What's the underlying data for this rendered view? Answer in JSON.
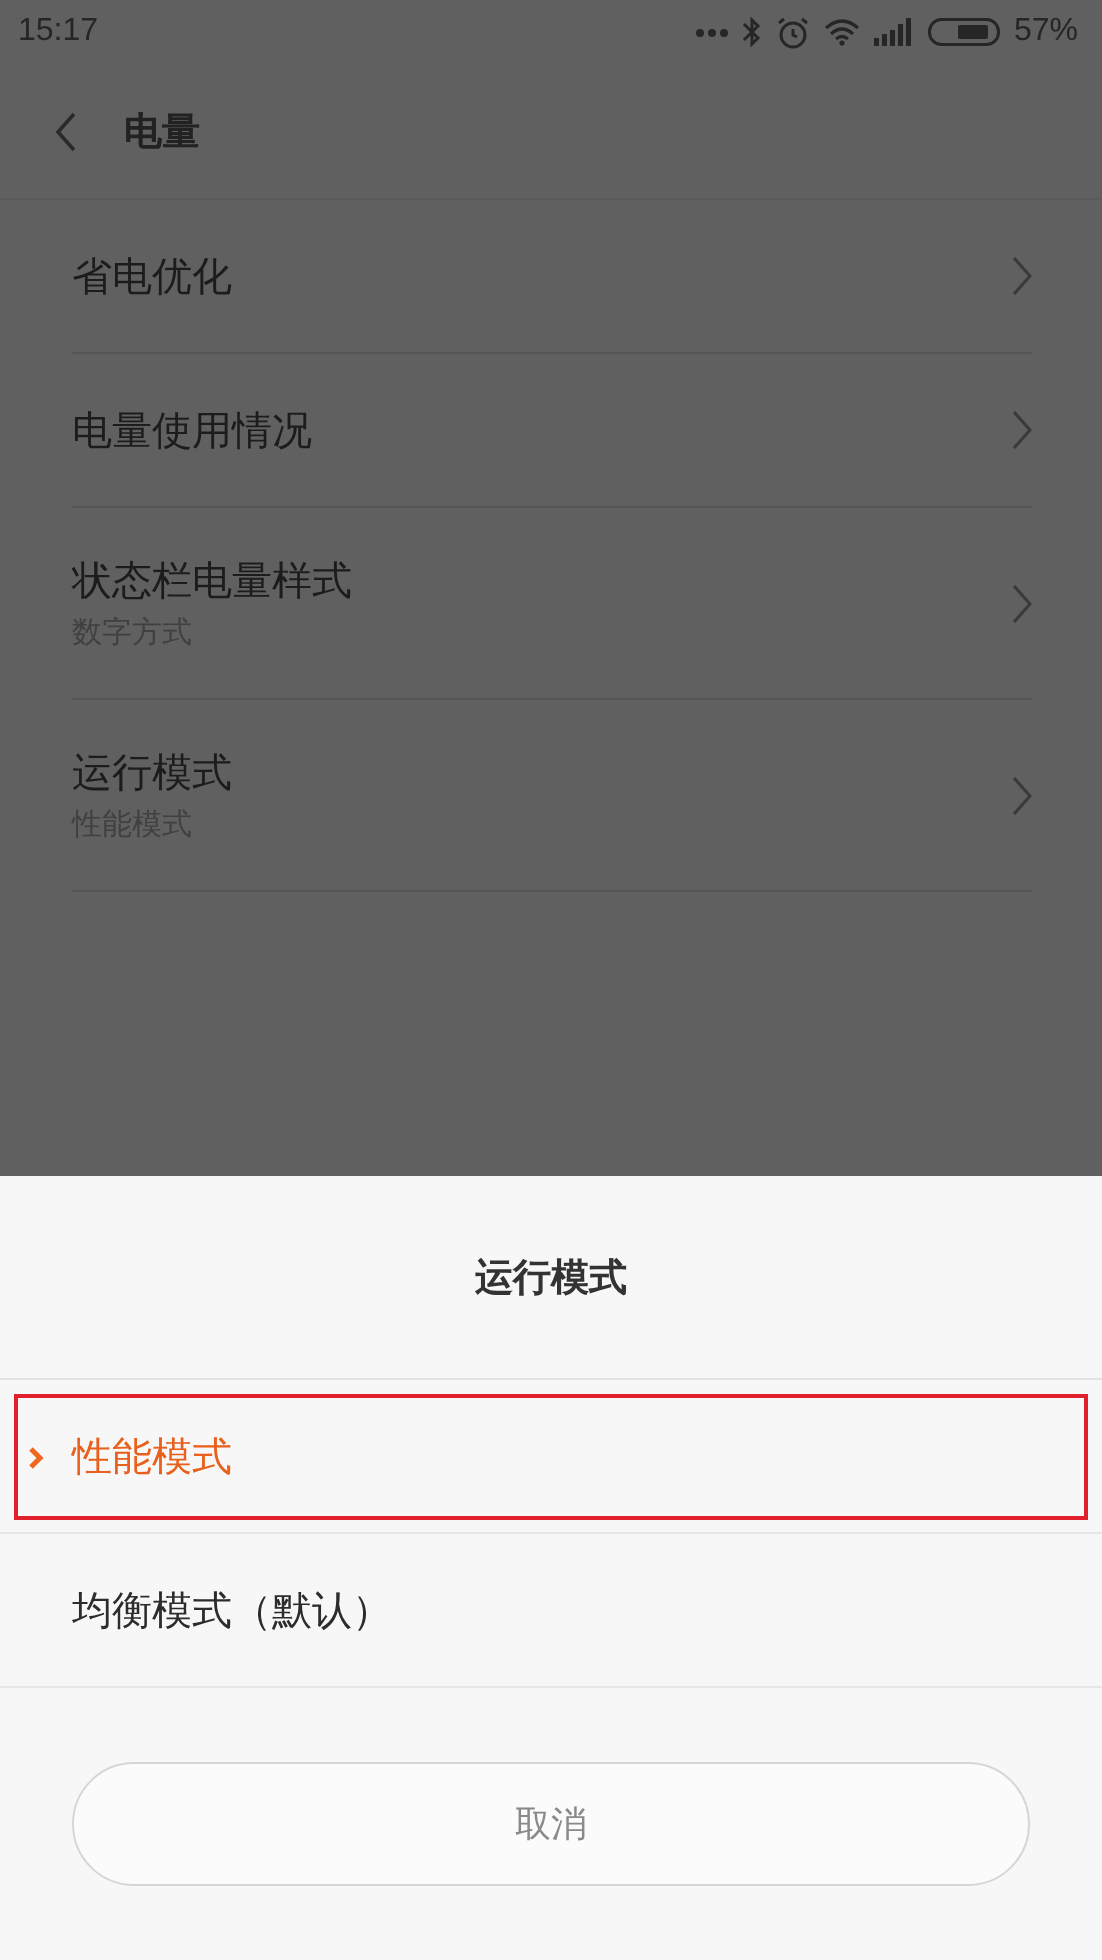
{
  "status_bar": {
    "time": "15:17",
    "battery": "57%"
  },
  "header": {
    "title": "电量"
  },
  "settings": [
    {
      "title": "省电优化"
    },
    {
      "title": "电量使用情况"
    },
    {
      "title": "状态栏电量样式",
      "subtitle": "数字方式"
    },
    {
      "title": "运行模式",
      "subtitle": "性能模式"
    }
  ],
  "sheet": {
    "title": "运行模式",
    "options": [
      {
        "label": "性能模式",
        "selected": true,
        "highlighted": true
      },
      {
        "label": "均衡模式（默认）",
        "selected": false,
        "highlighted": false
      }
    ],
    "cancel": "取消"
  }
}
